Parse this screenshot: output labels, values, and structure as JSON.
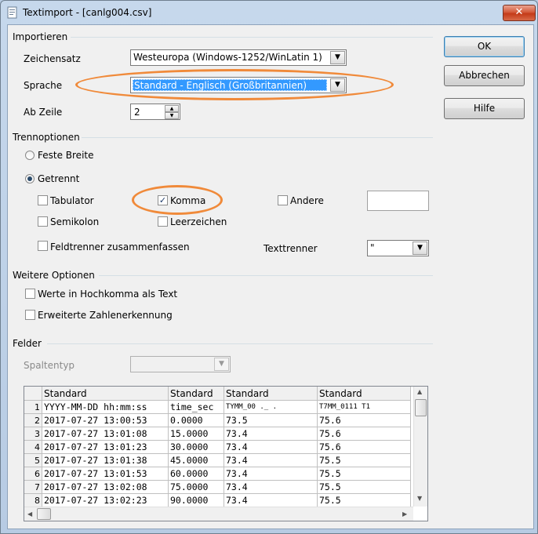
{
  "window": {
    "title": "Textimport - [canlg004.csv]",
    "close_label": "✕"
  },
  "buttons": {
    "ok": "OK",
    "cancel": "Abbrechen",
    "help": "Hilfe"
  },
  "import": {
    "section": "Importieren",
    "charset_label": "Zeichensatz",
    "charset_value": "Westeuropa (Windows-1252/WinLatin 1)",
    "language_label": "Sprache",
    "language_value": "Standard - Englisch (Großbritannien)",
    "from_row_label": "Ab Zeile",
    "from_row_value": "2"
  },
  "separator": {
    "section": "Trennoptionen",
    "fixed_width": "Feste Breite",
    "separated": "Getrennt",
    "tab": "Tabulator",
    "comma": "Komma",
    "other": "Andere",
    "semicolon": "Semikolon",
    "space": "Leerzeichen",
    "merge": "Feldtrenner zusammenfassen",
    "text_delimiter_label": "Texttrenner",
    "text_delimiter_value": "\""
  },
  "options": {
    "section": "Weitere Optionen",
    "quoted_as_text": "Werte in Hochkomma als Text",
    "detect_special": "Erweiterte Zahlenerkennung"
  },
  "fields": {
    "section": "Felder",
    "column_type_label": "Spaltentyp",
    "column_headers": [
      "Standard",
      "Standard",
      "Standard",
      "Standard"
    ],
    "rows": [
      {
        "n": "1",
        "cells": [
          "YYYY-MM-DD hh:mm:ss",
          "time_sec",
          "TYMM_00 ._ .",
          "T7MM_0111 T1"
        ]
      },
      {
        "n": "2",
        "cells": [
          "2017-07-27 13:00:53",
          "0.0000",
          "73.5",
          "75.6"
        ]
      },
      {
        "n": "3",
        "cells": [
          "2017-07-27 13:01:08",
          "15.0000",
          "73.4",
          "75.6"
        ]
      },
      {
        "n": "4",
        "cells": [
          "2017-07-27 13:01:23",
          "30.0000",
          "73.4",
          "75.6"
        ]
      },
      {
        "n": "5",
        "cells": [
          "2017-07-27 13:01:38",
          "45.0000",
          "73.4",
          "75.5"
        ]
      },
      {
        "n": "6",
        "cells": [
          "2017-07-27 13:01:53",
          "60.0000",
          "73.4",
          "75.5"
        ]
      },
      {
        "n": "7",
        "cells": [
          "2017-07-27 13:02:08",
          "75.0000",
          "73.4",
          "75.5"
        ]
      },
      {
        "n": "8",
        "cells": [
          "2017-07-27 13:02:23",
          "90.0000",
          "73.4",
          "75.5"
        ]
      }
    ]
  },
  "colors": {
    "highlight": "#f08a3a",
    "selection": "#3399ff"
  }
}
